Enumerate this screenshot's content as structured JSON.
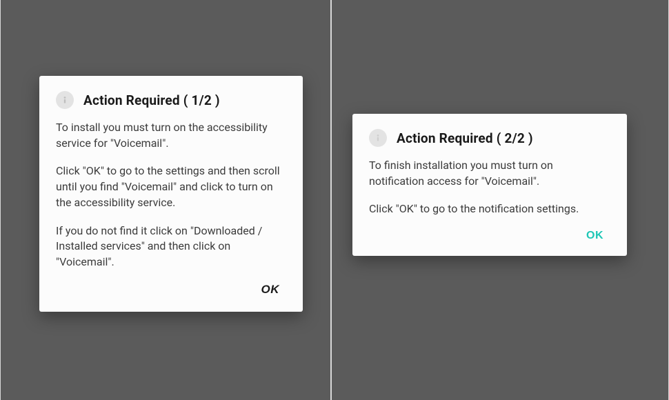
{
  "dialogs": {
    "left": {
      "title": "Action Required ( 1/2 )",
      "paragraphs": [
        "To install you must turn on the accessibility service for \"Voicemail\".",
        "Click \"OK\" to go to the settings and then scroll until you find \"Voicemail\" and click to turn on the accessibility service.",
        "If you do not find it click on \"Downloaded / Installed services\" and then click on \"Voicemail\"."
      ],
      "ok_label": "OK"
    },
    "right": {
      "title": "Action Required ( 2/2 )",
      "paragraphs": [
        "To finish installation you must turn on notification access for \"Voicemail\".",
        "Click \"OK\" to go to the notification settings."
      ],
      "ok_label": "OK"
    }
  },
  "colors": {
    "accent_teal": "#1ec7b6"
  }
}
